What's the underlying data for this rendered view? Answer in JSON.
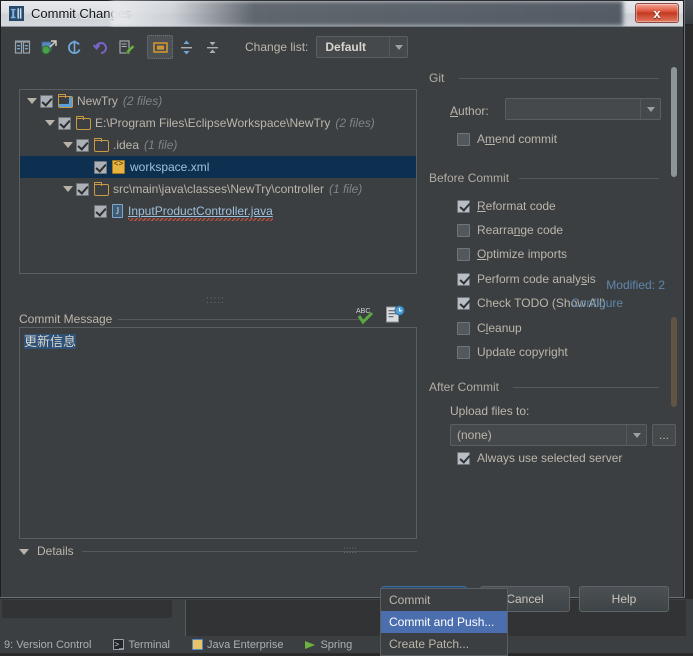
{
  "window": {
    "title": "Commit Changes",
    "title_icon": "intellij-logo-icon",
    "close_label": "x"
  },
  "toolbar": {
    "icons": [
      {
        "name": "show-diff-icon",
        "glyph": "diff"
      },
      {
        "name": "revert-group-icon",
        "glyph": "group"
      },
      {
        "name": "refresh-icon",
        "glyph": "refresh"
      },
      {
        "name": "rollback-icon",
        "glyph": "undo"
      },
      {
        "name": "edit-source-icon",
        "glyph": "edit"
      },
      {
        "name": "group-by-directory-icon",
        "glyph": "directory",
        "selected": true
      },
      {
        "name": "expand-all-icon",
        "glyph": "expand"
      },
      {
        "name": "collapse-all-icon",
        "glyph": "collapse"
      }
    ],
    "changelist_label": "Change list:",
    "changelist_value": "Default"
  },
  "tree": {
    "rows": [
      {
        "indent": 0,
        "twisty": true,
        "checked": true,
        "icon": "module-folder-icon",
        "label": "NewTry",
        "count": "(2 files)",
        "selected": false,
        "style": "plain"
      },
      {
        "indent": 1,
        "twisty": true,
        "checked": true,
        "icon": "folder-icon",
        "label": "E:\\Program Files\\EclipseWorkspace\\NewTry",
        "count": "(2 files)",
        "selected": false,
        "style": "plain"
      },
      {
        "indent": 2,
        "twisty": true,
        "checked": true,
        "icon": "folder-icon",
        "label": ".idea",
        "count": "(1 file)",
        "selected": false,
        "style": "plain"
      },
      {
        "indent": 3,
        "twisty": false,
        "checked": true,
        "icon": "xml-file-icon",
        "label": "workspace.xml",
        "count": "",
        "selected": true,
        "style": "file-selected"
      },
      {
        "indent": 2,
        "twisty": true,
        "checked": true,
        "icon": "folder-icon",
        "label": "src\\main\\java\\classes\\NewTry\\controller",
        "count": "(1 file)",
        "selected": false,
        "style": "plain"
      },
      {
        "indent": 3,
        "twisty": false,
        "checked": true,
        "icon": "java-file-icon",
        "label": "InputProductController.java",
        "count": "",
        "selected": false,
        "style": "java-link"
      }
    ],
    "modified_label": "Modified: 2"
  },
  "commit_message": {
    "label": "Commit Message",
    "value": "更新信息",
    "icons": [
      {
        "name": "spellcheck-icon",
        "label": "ABC"
      },
      {
        "name": "message-history-icon",
        "label": "history"
      }
    ]
  },
  "details": {
    "label": "Details"
  },
  "git_section": {
    "label": "Git",
    "author_label": "Author:",
    "author_value": "",
    "amend_label": "Amend commit",
    "amend_checked": false
  },
  "before_commit": {
    "label": "Before Commit",
    "options": [
      {
        "label": "Reformat code",
        "checked": true,
        "mnemonic": "R"
      },
      {
        "label": "Rearrange code",
        "checked": false,
        "mnemonic": "n"
      },
      {
        "label": "Optimize imports",
        "checked": false,
        "mnemonic": "O"
      },
      {
        "label": "Perform code analysis",
        "checked": true,
        "mnemonic": "s"
      },
      {
        "label": "Check TODO (Show All)",
        "checked": true,
        "mnemonic": ""
      },
      {
        "label": "Cleanup",
        "checked": false,
        "mnemonic": "l"
      },
      {
        "label": "Update copyright",
        "checked": false,
        "mnemonic": ""
      }
    ],
    "configure_link": "Configure"
  },
  "after_commit": {
    "label": "After Commit",
    "upload_label": "Upload files to:",
    "upload_value": "(none)",
    "browse_label": "...",
    "always_use_label": "Always use selected server",
    "always_use_checked": true
  },
  "buttons": {
    "commit": "Commit",
    "cancel": "Cancel",
    "help": "Help"
  },
  "commit_menu": {
    "items": [
      {
        "label": "Commit",
        "highlight": false
      },
      {
        "label": "Commit and Push...",
        "highlight": true
      },
      {
        "label": "Create Patch...",
        "highlight": false
      }
    ]
  },
  "status_bar": {
    "items": [
      {
        "label": "9: Version Control",
        "icon": "version-control-icon"
      },
      {
        "label": "Terminal",
        "icon": "terminal-icon"
      },
      {
        "label": "Java Enterprise",
        "icon": "java-enterprise-icon"
      },
      {
        "label": "Spring",
        "icon": "spring-icon"
      }
    ]
  },
  "colors": {
    "accent_link": "#5f87ad",
    "selection": "#0d3050",
    "menu_highlight": "#4b6eaf",
    "panel_bg": "#3c3f41"
  }
}
